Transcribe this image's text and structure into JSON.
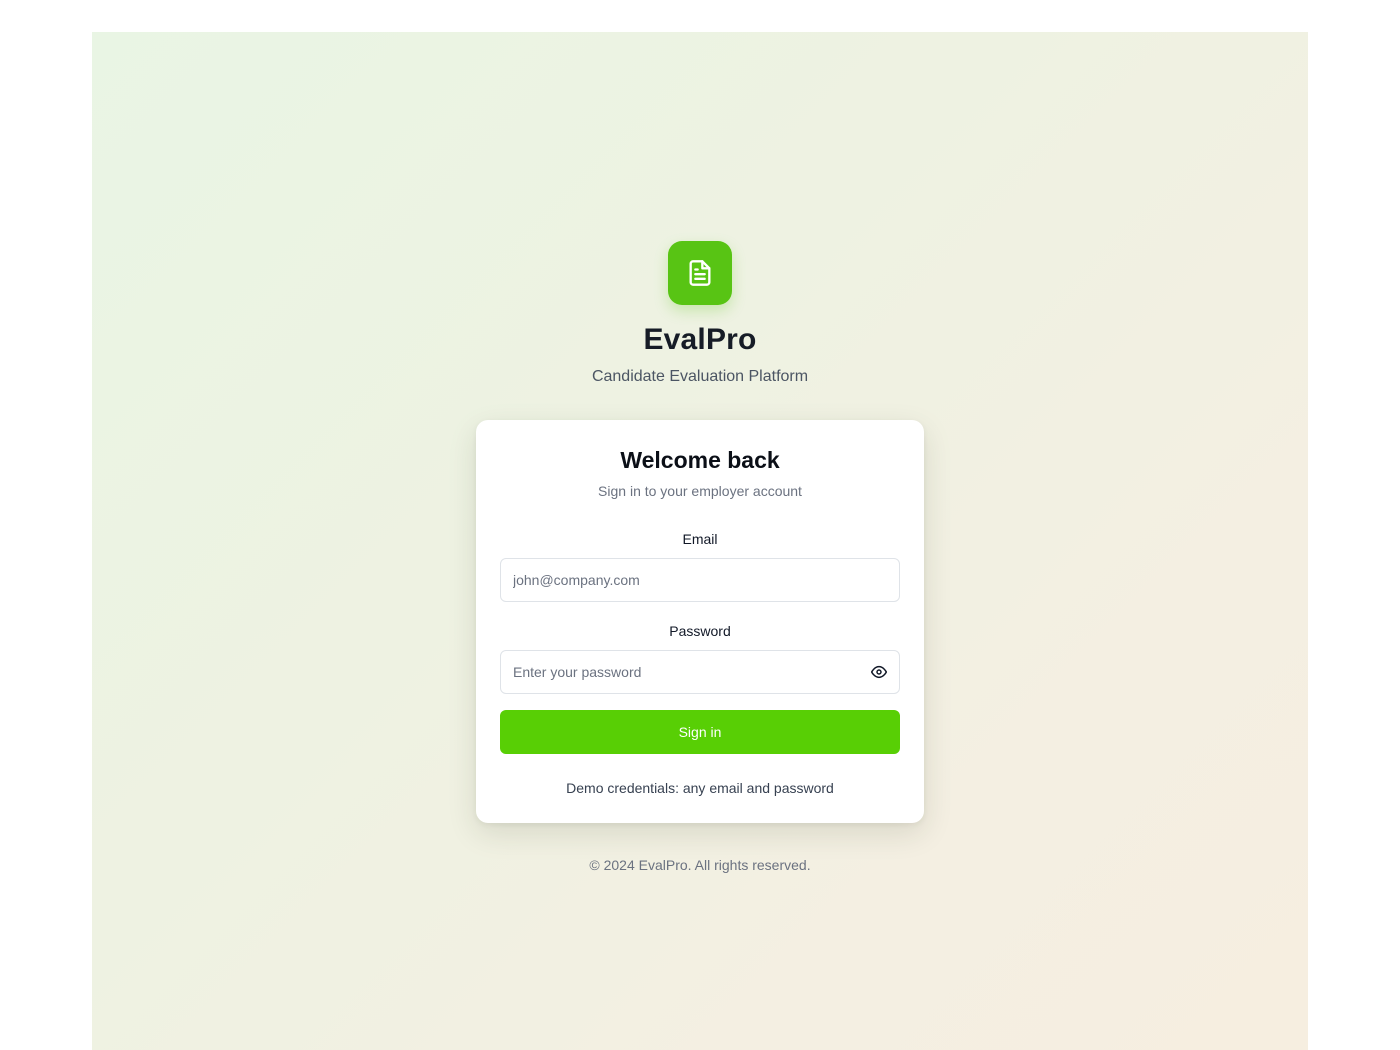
{
  "brand": {
    "name": "EvalPro",
    "tagline": "Candidate Evaluation Platform",
    "logo_icon": "file-text-icon",
    "accent_color": "#58cf05"
  },
  "card": {
    "title": "Welcome back",
    "subtitle": "Sign in to your employer account",
    "email": {
      "label": "Email",
      "value": "",
      "placeholder": "john@company.com"
    },
    "password": {
      "label": "Password",
      "value": "",
      "placeholder": "Enter your password",
      "toggle_icon": "eye-icon"
    },
    "submit_label": "Sign in",
    "demo_note": "Demo credentials: any email and password"
  },
  "footer": {
    "copyright": "© 2024 EvalPro. All rights reserved."
  }
}
